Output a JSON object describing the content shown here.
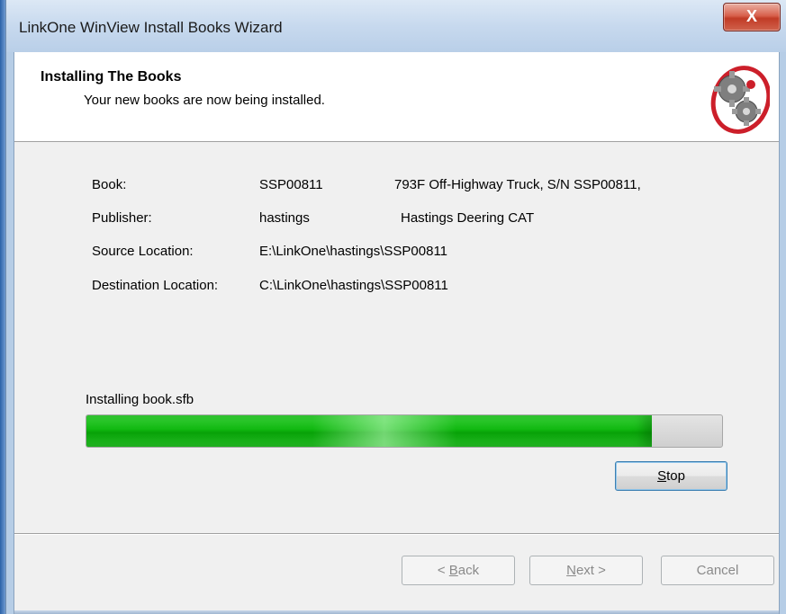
{
  "window": {
    "title": "LinkOne WinView Install Books Wizard",
    "close_glyph": "X"
  },
  "header": {
    "title": "Installing The Books",
    "subtitle": "Your new books are now being installed.",
    "icon": "gears-icon"
  },
  "details": {
    "book_label": "Book:",
    "book_id": "SSP00811",
    "book_desc": "793F Off-Highway Truck, S/N SSP00811,",
    "publisher_label": "Publisher:",
    "publisher_id": "hastings",
    "publisher_name": "Hastings Deering CAT",
    "source_label": "Source Location:",
    "source_path": "E:\\LinkOne\\hastings\\SSP00811",
    "destination_label": "Destination Location:",
    "destination_path": "C:\\LinkOne\\hastings\\SSP00811"
  },
  "progress": {
    "caption": "Installing book.sfb",
    "percent": 89,
    "color": "#10b710"
  },
  "buttons": {
    "stop": {
      "prefix": "",
      "accel": "S",
      "suffix": "top"
    },
    "back": {
      "prefix": "< ",
      "accel": "B",
      "suffix": "ack"
    },
    "next": {
      "prefix": "",
      "accel": "N",
      "suffix": "ext >"
    },
    "cancel": "Cancel"
  }
}
